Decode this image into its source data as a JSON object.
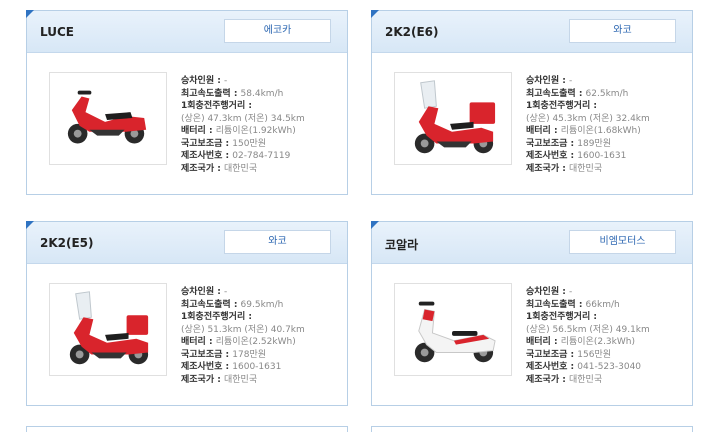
{
  "colors": {
    "accent": "#2f73c2",
    "header_bg": "#dde9f6",
    "card_border": "#b7cfe6",
    "brand_text": "#2b66b1",
    "scooter_red": "#d9242c"
  },
  "spec_labels": {
    "capacity": "승차인원 : ",
    "top_speed": "최고속도출력 : ",
    "range": "1회충전주행거리 : ",
    "battery": "배터리 : ",
    "subsidy": "국고보조금 : ",
    "contact": "제조사번호 : ",
    "country": "제조국가 : "
  },
  "cards": [
    {
      "model": "LUCE",
      "brand": "에코카",
      "image_icon": "red-scooter-image",
      "capacity": "-",
      "top_speed": "58.4km/h",
      "range": "(상온) 47.3km (저온) 34.5km",
      "battery": "리튬이온(1.92kWh)",
      "subsidy": "150만원",
      "contact": "02-784-7119",
      "country": "대한민국"
    },
    {
      "model": "2K2(E6)",
      "brand": "와코",
      "image_icon": "red-delivery-scooter-image",
      "capacity": "-",
      "top_speed": "62.5km/h",
      "range": "(상온) 45.3km (저온) 32.4km",
      "battery": "리튬이온(1.68kWh)",
      "subsidy": "189만원",
      "contact": "1600-1631",
      "country": "대한민국"
    },
    {
      "model": "2K2(E5)",
      "brand": "와코",
      "image_icon": "red-delivery-scooter-image",
      "capacity": "-",
      "top_speed": "69.5km/h",
      "range": "(상온) 51.3km (저온) 40.7km",
      "battery": "리튬이온(2.52kWh)",
      "subsidy": "178만원",
      "contact": "1600-1631",
      "country": "대한민국"
    },
    {
      "model": "코알라",
      "brand": "비엠모터스",
      "image_icon": "white-red-scooter-image",
      "capacity": "-",
      "top_speed": "66km/h",
      "range": "(상온) 56.5km (저온) 49.1km",
      "battery": "리튬이온(2.3kWh)",
      "subsidy": "156만원",
      "contact": "041-523-3040",
      "country": "대한민국"
    }
  ]
}
